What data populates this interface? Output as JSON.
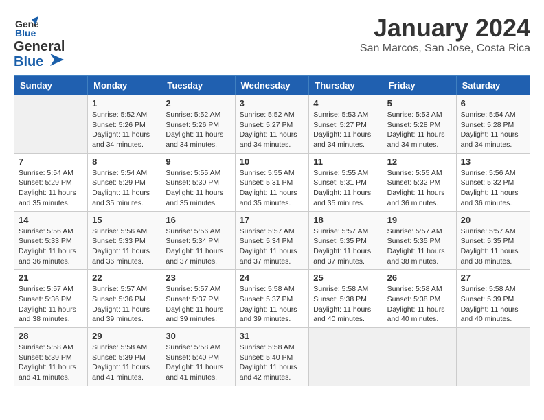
{
  "header": {
    "logo_line1": "General",
    "logo_line2": "Blue",
    "month_title": "January 2024",
    "location": "San Marcos, San Jose, Costa Rica"
  },
  "days_of_week": [
    "Sunday",
    "Monday",
    "Tuesday",
    "Wednesday",
    "Thursday",
    "Friday",
    "Saturday"
  ],
  "weeks": [
    [
      {
        "day": "",
        "sunrise": "",
        "sunset": "",
        "daylight": ""
      },
      {
        "day": "1",
        "sunrise": "Sunrise: 5:52 AM",
        "sunset": "Sunset: 5:26 PM",
        "daylight": "Daylight: 11 hours and 34 minutes."
      },
      {
        "day": "2",
        "sunrise": "Sunrise: 5:52 AM",
        "sunset": "Sunset: 5:26 PM",
        "daylight": "Daylight: 11 hours and 34 minutes."
      },
      {
        "day": "3",
        "sunrise": "Sunrise: 5:52 AM",
        "sunset": "Sunset: 5:27 PM",
        "daylight": "Daylight: 11 hours and 34 minutes."
      },
      {
        "day": "4",
        "sunrise": "Sunrise: 5:53 AM",
        "sunset": "Sunset: 5:27 PM",
        "daylight": "Daylight: 11 hours and 34 minutes."
      },
      {
        "day": "5",
        "sunrise": "Sunrise: 5:53 AM",
        "sunset": "Sunset: 5:28 PM",
        "daylight": "Daylight: 11 hours and 34 minutes."
      },
      {
        "day": "6",
        "sunrise": "Sunrise: 5:54 AM",
        "sunset": "Sunset: 5:28 PM",
        "daylight": "Daylight: 11 hours and 34 minutes."
      }
    ],
    [
      {
        "day": "7",
        "sunrise": "Sunrise: 5:54 AM",
        "sunset": "Sunset: 5:29 PM",
        "daylight": "Daylight: 11 hours and 35 minutes."
      },
      {
        "day": "8",
        "sunrise": "Sunrise: 5:54 AM",
        "sunset": "Sunset: 5:29 PM",
        "daylight": "Daylight: 11 hours and 35 minutes."
      },
      {
        "day": "9",
        "sunrise": "Sunrise: 5:55 AM",
        "sunset": "Sunset: 5:30 PM",
        "daylight": "Daylight: 11 hours and 35 minutes."
      },
      {
        "day": "10",
        "sunrise": "Sunrise: 5:55 AM",
        "sunset": "Sunset: 5:31 PM",
        "daylight": "Daylight: 11 hours and 35 minutes."
      },
      {
        "day": "11",
        "sunrise": "Sunrise: 5:55 AM",
        "sunset": "Sunset: 5:31 PM",
        "daylight": "Daylight: 11 hours and 35 minutes."
      },
      {
        "day": "12",
        "sunrise": "Sunrise: 5:55 AM",
        "sunset": "Sunset: 5:32 PM",
        "daylight": "Daylight: 11 hours and 36 minutes."
      },
      {
        "day": "13",
        "sunrise": "Sunrise: 5:56 AM",
        "sunset": "Sunset: 5:32 PM",
        "daylight": "Daylight: 11 hours and 36 minutes."
      }
    ],
    [
      {
        "day": "14",
        "sunrise": "Sunrise: 5:56 AM",
        "sunset": "Sunset: 5:33 PM",
        "daylight": "Daylight: 11 hours and 36 minutes."
      },
      {
        "day": "15",
        "sunrise": "Sunrise: 5:56 AM",
        "sunset": "Sunset: 5:33 PM",
        "daylight": "Daylight: 11 hours and 36 minutes."
      },
      {
        "day": "16",
        "sunrise": "Sunrise: 5:56 AM",
        "sunset": "Sunset: 5:34 PM",
        "daylight": "Daylight: 11 hours and 37 minutes."
      },
      {
        "day": "17",
        "sunrise": "Sunrise: 5:57 AM",
        "sunset": "Sunset: 5:34 PM",
        "daylight": "Daylight: 11 hours and 37 minutes."
      },
      {
        "day": "18",
        "sunrise": "Sunrise: 5:57 AM",
        "sunset": "Sunset: 5:35 PM",
        "daylight": "Daylight: 11 hours and 37 minutes."
      },
      {
        "day": "19",
        "sunrise": "Sunrise: 5:57 AM",
        "sunset": "Sunset: 5:35 PM",
        "daylight": "Daylight: 11 hours and 38 minutes."
      },
      {
        "day": "20",
        "sunrise": "Sunrise: 5:57 AM",
        "sunset": "Sunset: 5:35 PM",
        "daylight": "Daylight: 11 hours and 38 minutes."
      }
    ],
    [
      {
        "day": "21",
        "sunrise": "Sunrise: 5:57 AM",
        "sunset": "Sunset: 5:36 PM",
        "daylight": "Daylight: 11 hours and 38 minutes."
      },
      {
        "day": "22",
        "sunrise": "Sunrise: 5:57 AM",
        "sunset": "Sunset: 5:36 PM",
        "daylight": "Daylight: 11 hours and 39 minutes."
      },
      {
        "day": "23",
        "sunrise": "Sunrise: 5:57 AM",
        "sunset": "Sunset: 5:37 PM",
        "daylight": "Daylight: 11 hours and 39 minutes."
      },
      {
        "day": "24",
        "sunrise": "Sunrise: 5:58 AM",
        "sunset": "Sunset: 5:37 PM",
        "daylight": "Daylight: 11 hours and 39 minutes."
      },
      {
        "day": "25",
        "sunrise": "Sunrise: 5:58 AM",
        "sunset": "Sunset: 5:38 PM",
        "daylight": "Daylight: 11 hours and 40 minutes."
      },
      {
        "day": "26",
        "sunrise": "Sunrise: 5:58 AM",
        "sunset": "Sunset: 5:38 PM",
        "daylight": "Daylight: 11 hours and 40 minutes."
      },
      {
        "day": "27",
        "sunrise": "Sunrise: 5:58 AM",
        "sunset": "Sunset: 5:39 PM",
        "daylight": "Daylight: 11 hours and 40 minutes."
      }
    ],
    [
      {
        "day": "28",
        "sunrise": "Sunrise: 5:58 AM",
        "sunset": "Sunset: 5:39 PM",
        "daylight": "Daylight: 11 hours and 41 minutes."
      },
      {
        "day": "29",
        "sunrise": "Sunrise: 5:58 AM",
        "sunset": "Sunset: 5:39 PM",
        "daylight": "Daylight: 11 hours and 41 minutes."
      },
      {
        "day": "30",
        "sunrise": "Sunrise: 5:58 AM",
        "sunset": "Sunset: 5:40 PM",
        "daylight": "Daylight: 11 hours and 41 minutes."
      },
      {
        "day": "31",
        "sunrise": "Sunrise: 5:58 AM",
        "sunset": "Sunset: 5:40 PM",
        "daylight": "Daylight: 11 hours and 42 minutes."
      },
      {
        "day": "",
        "sunrise": "",
        "sunset": "",
        "daylight": ""
      },
      {
        "day": "",
        "sunrise": "",
        "sunset": "",
        "daylight": ""
      },
      {
        "day": "",
        "sunrise": "",
        "sunset": "",
        "daylight": ""
      }
    ]
  ]
}
